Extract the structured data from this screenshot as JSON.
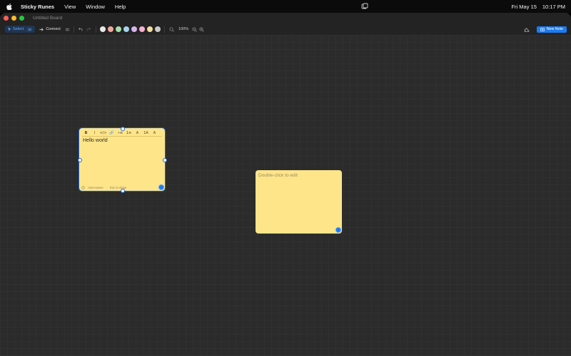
{
  "menubar": {
    "app_name": "Sticky Runes",
    "items": [
      "View",
      "Window",
      "Help"
    ],
    "date": "Fri May 15",
    "time": "10:17 PM"
  },
  "window": {
    "title": "Untitled Board"
  },
  "toolbar": {
    "select_label": "Select",
    "select_key": "V",
    "connect_label": "Connect",
    "connect_key": "C",
    "zoom": "100%",
    "new_note_label": "New Note",
    "colors": [
      "#e8e8e8",
      "#f0a79a",
      "#a6dfa8",
      "#a5d4ee",
      "#d9b3ee",
      "#f5b0d0",
      "#f3dca0",
      "#c9c9c9"
    ]
  },
  "notes": {
    "editing": {
      "text": "Hello world",
      "footer_autosave": "Auto-saves",
      "footer_esc": "Esc to close",
      "format_buttons": [
        "B",
        "I",
        "</>",
        "🔗",
        "•≡",
        "1≡",
        "A",
        "1A",
        "A"
      ]
    },
    "idle": {
      "placeholder": "Double-click to edit"
    }
  },
  "colors": {
    "accent": "#1a7cf0",
    "note_yellow": "#ffe58a",
    "canvas_bg": "#2b2b2b"
  }
}
